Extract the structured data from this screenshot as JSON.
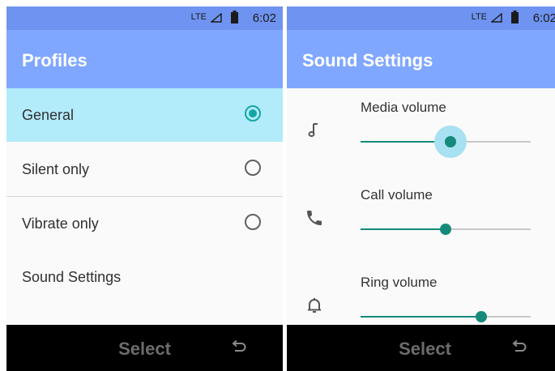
{
  "status": {
    "network": "LTE",
    "time": "6:02"
  },
  "left": {
    "title": "Profiles",
    "items": [
      {
        "label": "General",
        "selected": true
      },
      {
        "label": "Silent only",
        "selected": false
      },
      {
        "label": "Vibrate only",
        "selected": false
      },
      {
        "label": "Sound Settings"
      }
    ],
    "softkey_center": "Select"
  },
  "right": {
    "title": "Sound Settings",
    "volumes": [
      {
        "label": "Media volume",
        "icon": "music-note-icon",
        "level": 0.53,
        "focused": true
      },
      {
        "label": "Call volume",
        "icon": "phone-icon",
        "level": 0.5,
        "focused": false
      },
      {
        "label": "Ring volume",
        "icon": "bell-icon",
        "level": 0.71,
        "focused": false
      }
    ],
    "softkey_center": "Select"
  },
  "colors": {
    "status_bar": "#6f93f0",
    "app_bar": "#80a7ff",
    "selected_row": "#b2ebfa",
    "accent": "#14a6a3",
    "slider": "#158a7b",
    "softkey_bar": "#000000"
  }
}
